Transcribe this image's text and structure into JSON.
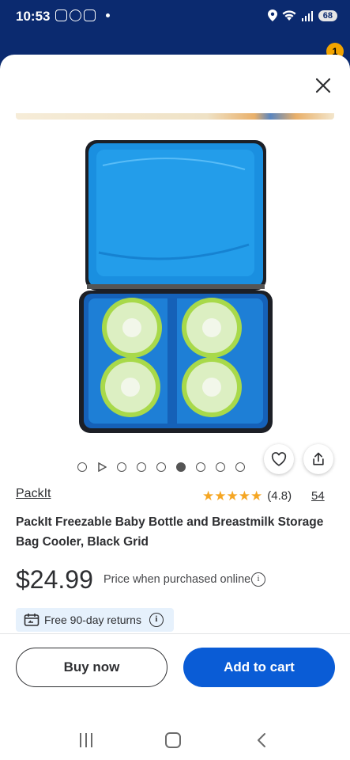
{
  "status_bar": {
    "time": "10:53",
    "battery": "68"
  },
  "header": {
    "cart_count": "1"
  },
  "product": {
    "brand": "PackIt",
    "rating_text": "(4.8)",
    "rating_stars": 5,
    "review_count": "54",
    "title": "PackIt Freezable Baby Bottle and Breastmilk Storage Bag Cooler, Black Grid",
    "price": "$24.99",
    "price_note": "Price when purchased online",
    "returns_label": "Free 90-day returns",
    "image_alt_icon": "product-image-cooler-bag"
  },
  "carousel": {
    "total_dots": 9,
    "active_index": 5
  },
  "actions": {
    "buy_now": "Buy now",
    "add_to_cart": "Add to cart"
  },
  "colors": {
    "brand_blue": "#0a5cd6",
    "header_navy": "#0b2a6f",
    "star": "#f5a623",
    "returns_bg": "#e6f1fc"
  }
}
